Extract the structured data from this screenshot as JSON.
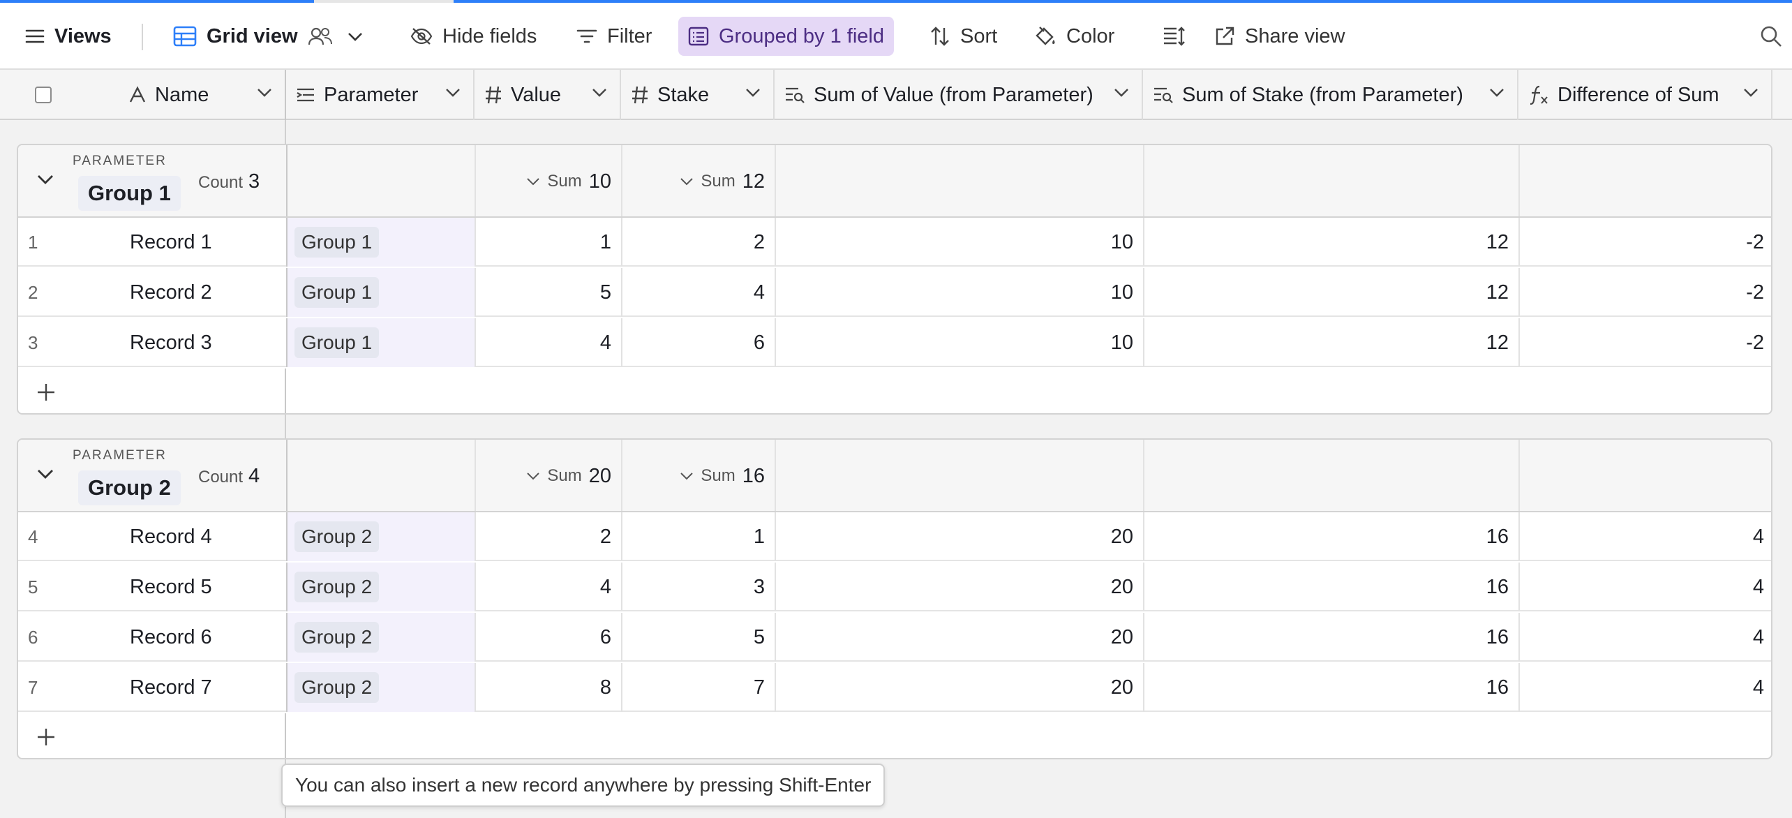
{
  "toolbar": {
    "views_label": "Views",
    "grid_view_label": "Grid view",
    "hide_fields_label": "Hide fields",
    "filter_label": "Filter",
    "grouped_label": "Grouped by 1 field",
    "sort_label": "Sort",
    "color_label": "Color",
    "share_label": "Share view"
  },
  "columns": {
    "name": "Name",
    "parameter": "Parameter",
    "value": "Value",
    "stake": "Stake",
    "sum_value": "Sum of Value (from Parameter)",
    "sum_stake": "Sum of Stake (from Parameter)",
    "difference": "Difference of Sum"
  },
  "groups": [
    {
      "label": "PARAMETER",
      "name": "Group 1",
      "count_label": "Count",
      "count": "3",
      "sum_label": "Sum",
      "value_sum": "10",
      "stake_sum": "12",
      "rows": [
        {
          "idx": "1",
          "name": "Record 1",
          "param": "Group 1",
          "value": "1",
          "stake": "2",
          "sum_value": "10",
          "sum_stake": "12",
          "diff": "-2"
        },
        {
          "idx": "2",
          "name": "Record 2",
          "param": "Group 1",
          "value": "5",
          "stake": "4",
          "sum_value": "10",
          "sum_stake": "12",
          "diff": "-2"
        },
        {
          "idx": "3",
          "name": "Record 3",
          "param": "Group 1",
          "value": "4",
          "stake": "6",
          "sum_value": "10",
          "sum_stake": "12",
          "diff": "-2"
        }
      ]
    },
    {
      "label": "PARAMETER",
      "name": "Group 2",
      "count_label": "Count",
      "count": "4",
      "sum_label": "Sum",
      "value_sum": "20",
      "stake_sum": "16",
      "rows": [
        {
          "idx": "4",
          "name": "Record 4",
          "param": "Group 2",
          "value": "2",
          "stake": "1",
          "sum_value": "20",
          "sum_stake": "16",
          "diff": "4"
        },
        {
          "idx": "5",
          "name": "Record 5",
          "param": "Group 2",
          "value": "4",
          "stake": "3",
          "sum_value": "20",
          "sum_stake": "16",
          "diff": "4"
        },
        {
          "idx": "6",
          "name": "Record 6",
          "param": "Group 2",
          "value": "6",
          "stake": "5",
          "sum_value": "20",
          "sum_stake": "16",
          "diff": "4"
        },
        {
          "idx": "7",
          "name": "Record 7",
          "param": "Group 2",
          "value": "8",
          "stake": "7",
          "sum_value": "20",
          "sum_stake": "16",
          "diff": "4"
        }
      ]
    }
  ],
  "tooltip": "You can also insert a new record anywhere by pressing Shift-Enter",
  "colors": {
    "accent": "#2d7ff9",
    "grouped_bg": "#e5d8f6",
    "param_cell_bg": "#f3f1fc"
  },
  "icons": [
    "menu-icon",
    "grid-icon",
    "people-icon",
    "chevron-down-icon",
    "eye-off-icon",
    "filter-icon",
    "group-list-icon",
    "sort-icon",
    "paint-bucket-icon",
    "row-height-icon",
    "share-icon",
    "search-icon",
    "text-type-icon",
    "link-field-icon",
    "number-icon",
    "rollup-icon",
    "formula-icon",
    "plus-icon"
  ]
}
